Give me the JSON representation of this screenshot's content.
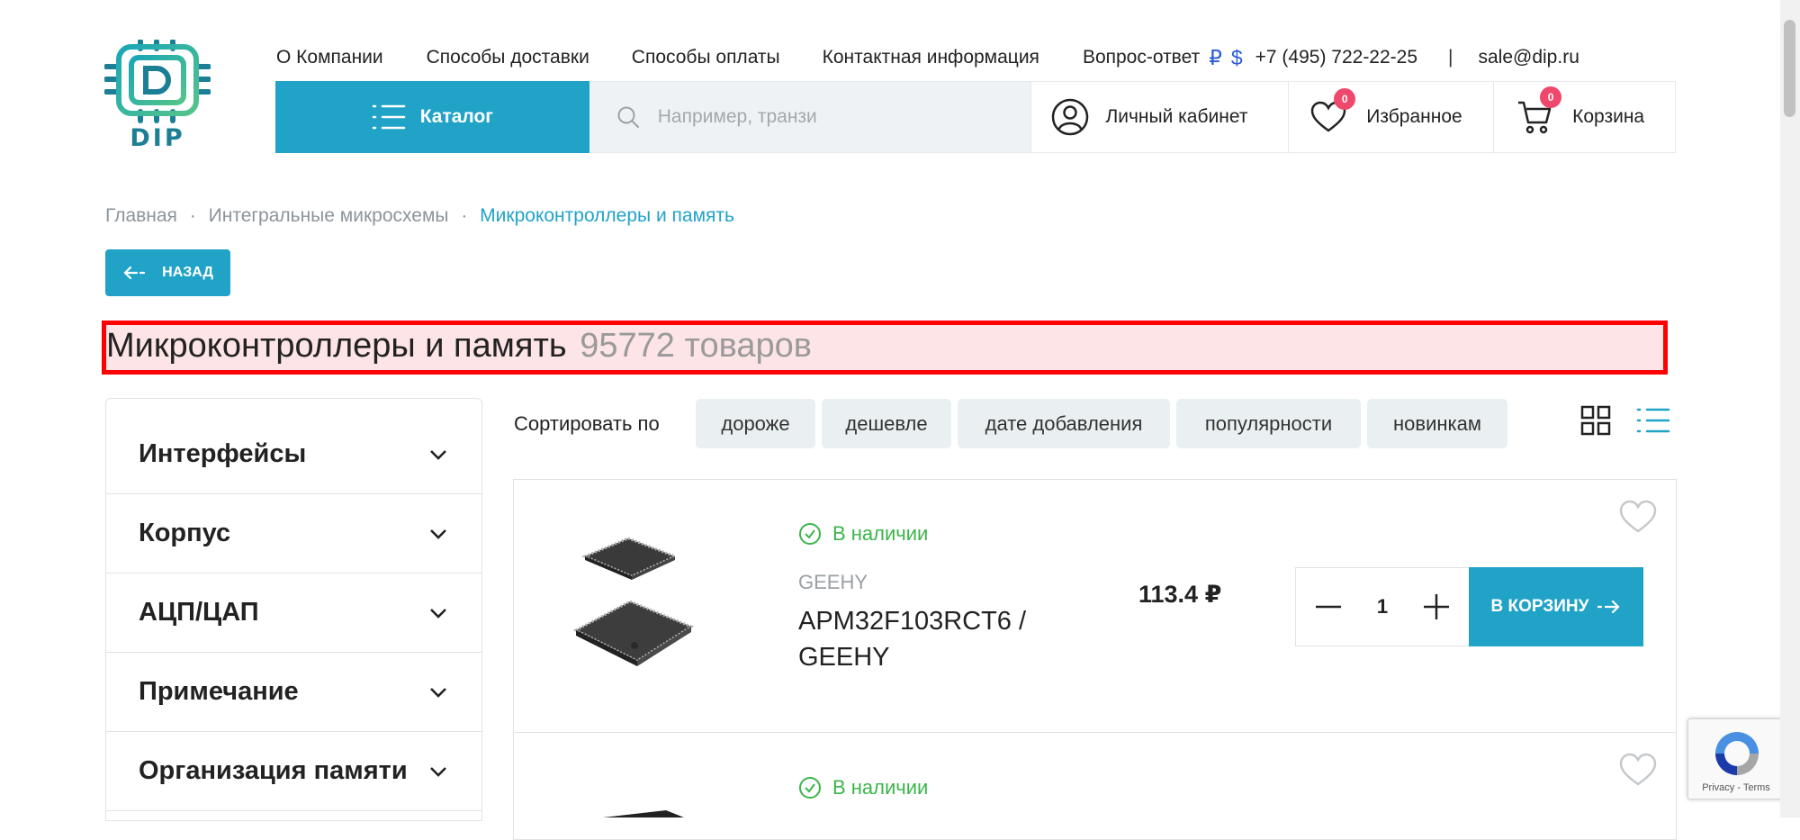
{
  "logo": {
    "text": "DIP"
  },
  "topnav": {
    "items": [
      "О Компании",
      "Способы доставки",
      "Способы оплаты",
      "Контактная информация",
      "Вопрос-ответ"
    ],
    "currency_rub": "₽",
    "currency_usd": "$",
    "phone": "+7 (495) 722-22-25",
    "separator": "|",
    "email": "sale@dip.ru"
  },
  "header": {
    "catalog_label": "Каталог",
    "search_placeholder": "Например, транзи",
    "account_label": "Личный кабинет",
    "favorites_label": "Избранное",
    "favorites_count": "0",
    "cart_label": "Корзина",
    "cart_count": "0"
  },
  "breadcrumb": {
    "items": [
      "Главная",
      "Интегральные микросхемы",
      "Микроконтроллеры и память"
    ],
    "sep": "·"
  },
  "back_label": "НАЗАД",
  "page": {
    "title": "Микроконтроллеры и память",
    "count": "95772 товаров"
  },
  "filters": [
    "Интерфейсы",
    "Корпус",
    "АЦП/ЦАП",
    "Примечание",
    "Организация памяти"
  ],
  "sort": {
    "label": "Сортировать по",
    "options": [
      "дороже",
      "дешевле",
      "дате добавления",
      "популярности",
      "новинкам"
    ]
  },
  "products": [
    {
      "stock": "В наличии",
      "brand": "GEEHY",
      "name": "APM32F103RCT6 / GEEHY",
      "price": "113.4 ₽",
      "qty": "1",
      "cart_label": "В КОРЗИНУ"
    },
    {
      "stock": "В наличии"
    }
  ],
  "recaptcha": {
    "text": "Privacy - Terms"
  },
  "colors": {
    "accent": "#21a3c8",
    "stock": "#3bb54a",
    "badge": "#f0476c"
  }
}
